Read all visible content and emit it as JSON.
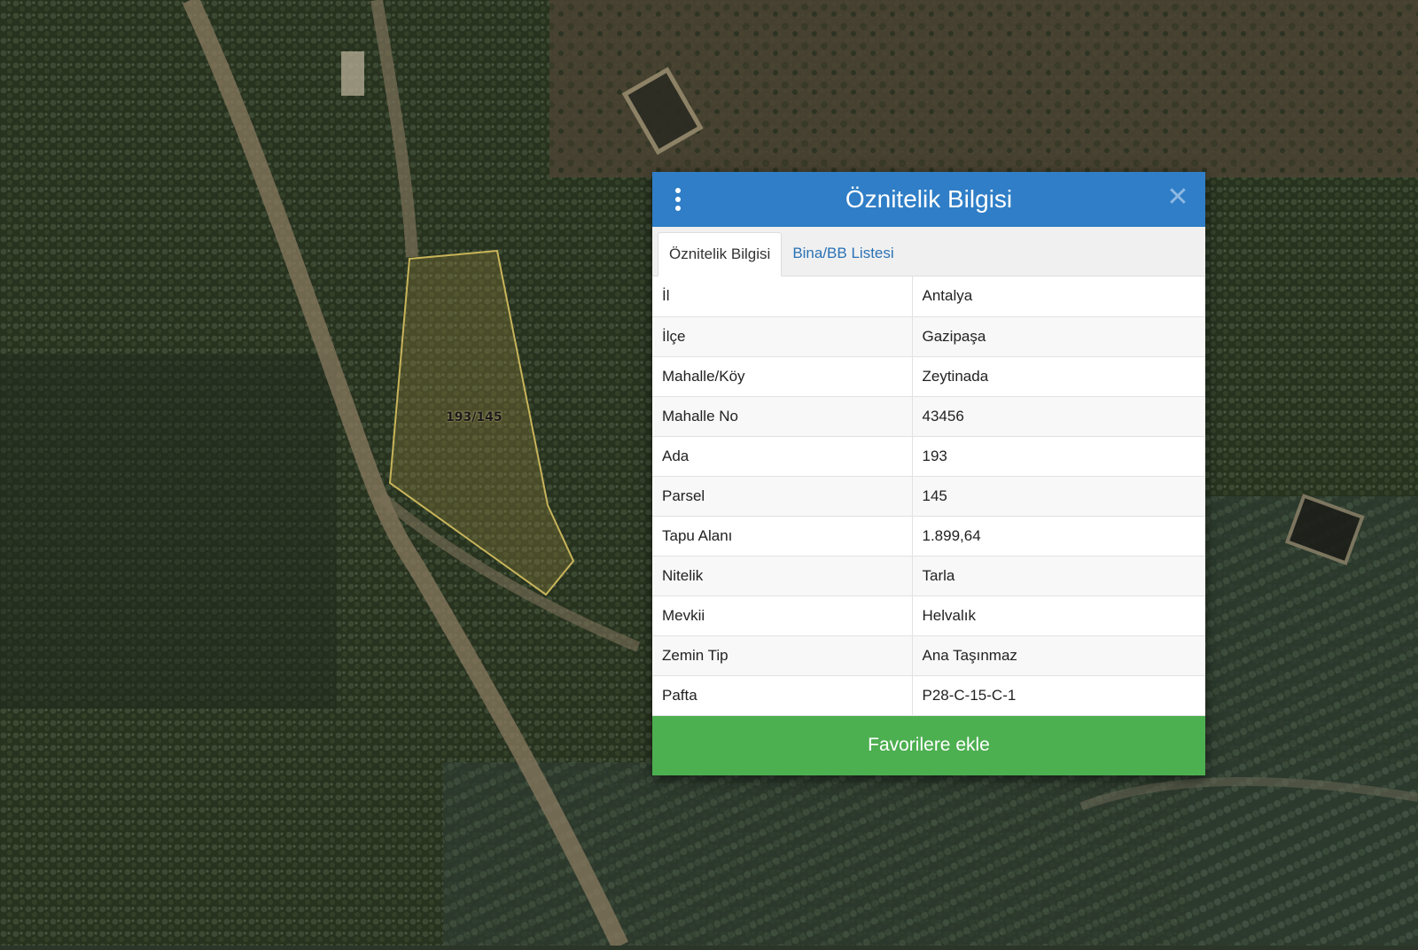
{
  "map": {
    "parcel_label": "193/145"
  },
  "panel": {
    "title": "Öznitelik Bilgisi",
    "tabs": [
      {
        "label": "Öznitelik Bilgisi",
        "active": true
      },
      {
        "label": "Bina/BB Listesi",
        "active": false
      }
    ],
    "rows": [
      {
        "key": "İl",
        "value": "Antalya"
      },
      {
        "key": "İlçe",
        "value": "Gazipaşa"
      },
      {
        "key": "Mahalle/Köy",
        "value": "Zeytinada"
      },
      {
        "key": "Mahalle No",
        "value": "43456"
      },
      {
        "key": "Ada",
        "value": "193"
      },
      {
        "key": "Parsel",
        "value": "145"
      },
      {
        "key": "Tapu Alanı",
        "value": "1.899,64"
      },
      {
        "key": "Nitelik",
        "value": "Tarla"
      },
      {
        "key": "Mevkii",
        "value": "Helvalık"
      },
      {
        "key": "Zemin Tip",
        "value": "Ana Taşınmaz"
      },
      {
        "key": "Pafta",
        "value": "P28-C-15-C-1"
      }
    ],
    "favorite_button": "Favorilere ekle",
    "icons": {
      "menu": "vertical-dots-icon",
      "close": "close-icon"
    },
    "colors": {
      "header": "#2f7ec7",
      "button": "#4caf50",
      "tab_link": "#2a72b5"
    }
  }
}
